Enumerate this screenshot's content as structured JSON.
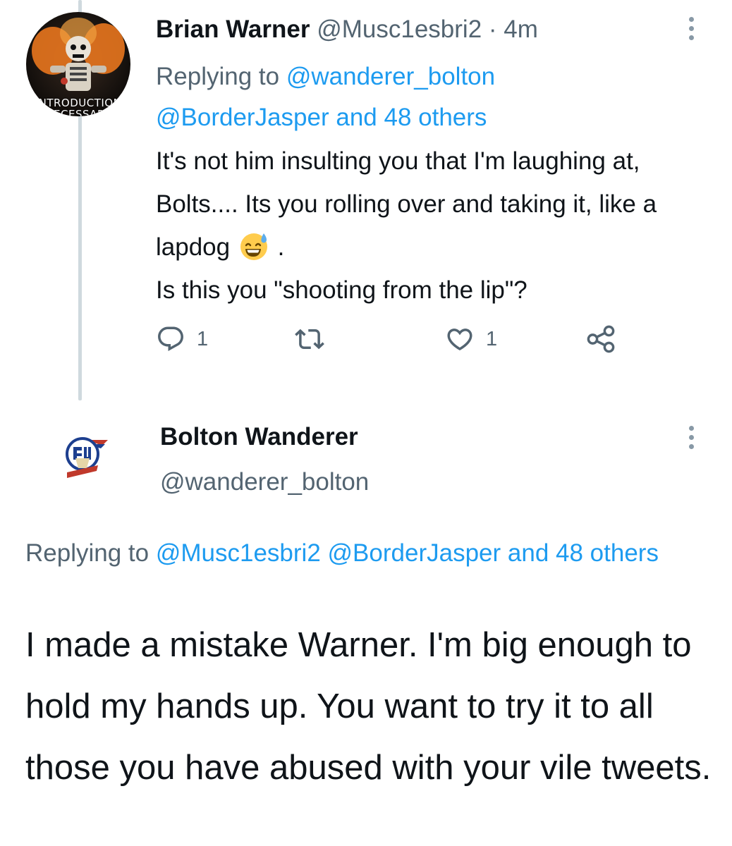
{
  "reply_tweet": {
    "author_name": "Brian Warner",
    "author_handle": "@Musc1esbri2",
    "separator": "·",
    "time": "4m",
    "avatar_lines": [
      "INTRODUCTION",
      "NECESSARY"
    ],
    "replying_prefix": "Replying to",
    "replying_mention_1": "@wanderer_bolton",
    "replying_mention_2": "@BorderJasper",
    "replying_others": "and 48 others",
    "body_part_1": "It's not him insulting you that I'm laughing at, Bolts.... Its you rolling over and taking it, like a lapdog",
    "body_emoji": "grinning-face-with-sweat",
    "body_part_2": ".",
    "body_line_2": "Is this you \"shooting from the lip\"?",
    "reply_count": "1",
    "retweet_count": "",
    "like_count": "1"
  },
  "main_tweet": {
    "author_name": "Bolton Wanderer",
    "author_handle": "@wanderer_bolton",
    "replying_prefix": "Replying to",
    "replying_mention_1": "@Musc1esbri2",
    "replying_mention_2": "@BorderJasper",
    "replying_others": "and 48 others",
    "body": "I made a mistake Warner. I'm big enough to hold my hands up. You want to try it to all those you have abused with your vile tweets."
  },
  "colors": {
    "link": "#1d9bf0",
    "secondary_text": "#536471",
    "primary_text": "#0f1419",
    "thread_line": "#cfd9de"
  },
  "icons": [
    "more-vertical-icon",
    "reply-icon",
    "retweet-icon",
    "like-icon",
    "share-icon",
    "emoji-grinning-sweat-icon"
  ]
}
